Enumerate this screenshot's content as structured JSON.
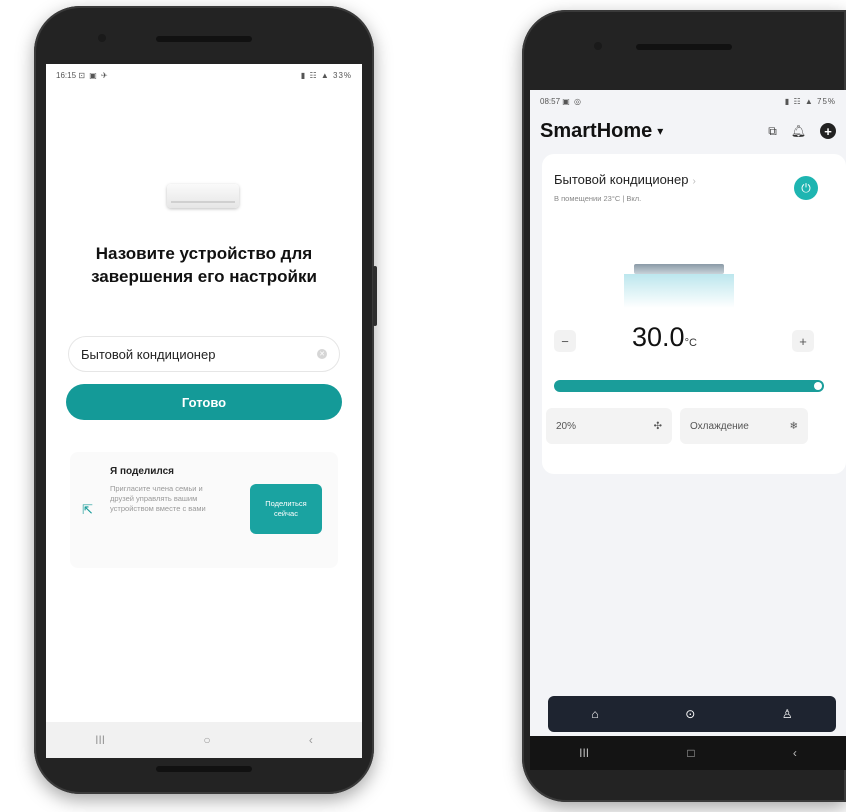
{
  "phone1": {
    "status": {
      "time": "16:15",
      "left_icons": "⊡ ▣ ✈",
      "right": "▮ ☷ ▲ 33%"
    },
    "title": "Назовите устройство для завершения его настройки",
    "device_name_value": "Бытовой кондиционер",
    "done_label": "Готово",
    "share": {
      "title": "Я поделился",
      "description": "Пригласите члена семьи и друзей управлять вашим устройством вместе с вами",
      "button_label": "Поделиться сейчас"
    },
    "nav": {
      "recent": "III",
      "home": "○",
      "back": "‹"
    }
  },
  "phone2": {
    "status": {
      "time": "08:57",
      "left_icons": "▣ ◎",
      "right": "▮ ☷ ▲ 75%"
    },
    "app_title": "SmartHome",
    "device": {
      "name": "Бытовой кондиционер",
      "subtitle": "В помещении 23°C | Вкл.",
      "temperature": "30.0",
      "unit": "°C",
      "fan_speed": "20%",
      "mode": "Охлаждение"
    },
    "nav": {
      "recent": "III",
      "home": "□",
      "back": "‹"
    }
  },
  "colors": {
    "accent": "#149a98",
    "dark_nav": "#1e2430"
  },
  "icons": [
    "power-icon",
    "fan-icon",
    "snowflake-icon",
    "home-icon",
    "bell-icon",
    "cast-icon",
    "add-icon",
    "share-icon",
    "profile-icon",
    "scene-icon"
  ]
}
